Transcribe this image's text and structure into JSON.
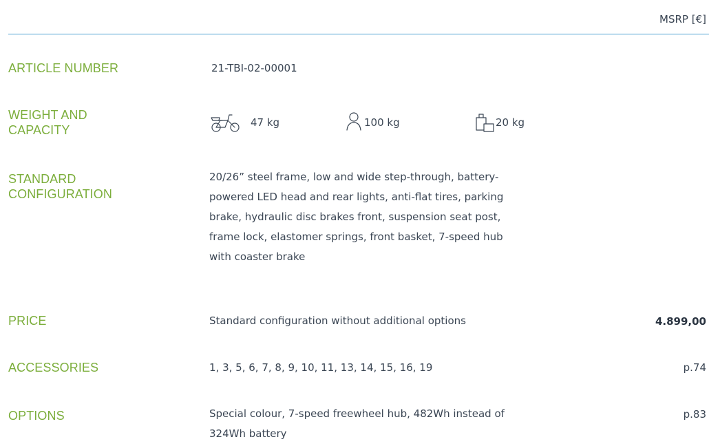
{
  "header": {
    "msrp_label": "MSRP [€]"
  },
  "article": {
    "label": "ARTICLE NUMBER",
    "value": "21-TBI-02-00001"
  },
  "weight": {
    "label_line1": "WEIGHT AND",
    "label_line2": "CAPACITY",
    "items": [
      {
        "icon": "bicycle-icon",
        "value": "47 kg"
      },
      {
        "icon": "person-icon",
        "value": "100 kg"
      },
      {
        "icon": "luggage-icon",
        "value": "20 kg"
      }
    ]
  },
  "config": {
    "label_line1": "STANDARD",
    "label_line2": "CONFIGURATION",
    "lines": [
      "20/26” steel frame, low and wide step-through, battery-",
      "powered LED head and rear lights, anti-flat tires, parking",
      "brake, hydraulic disc brakes front, suspension seat post,",
      "frame lock, elastomer springs, front basket, 7-speed hub",
      "with coaster brake"
    ]
  },
  "price": {
    "label": "PRICE",
    "description": "Standard configuration without additional options",
    "value": "4.899,00"
  },
  "accessories": {
    "label": "ACCESSORIES",
    "value": "1, 3, 5, 6, 7, 8, 9, 10, 11, 13, 14, 15, 16, 19",
    "page": "p.74"
  },
  "options": {
    "label": "OPTIONS",
    "lines": [
      "Special colour, 7-speed freewheel hub, 482Wh instead of",
      "324Wh battery"
    ],
    "page": "p.83"
  },
  "colors": {
    "accent_green": "#7cae3c",
    "rule_blue": "#4a9fd0",
    "text": "#3b4654"
  }
}
